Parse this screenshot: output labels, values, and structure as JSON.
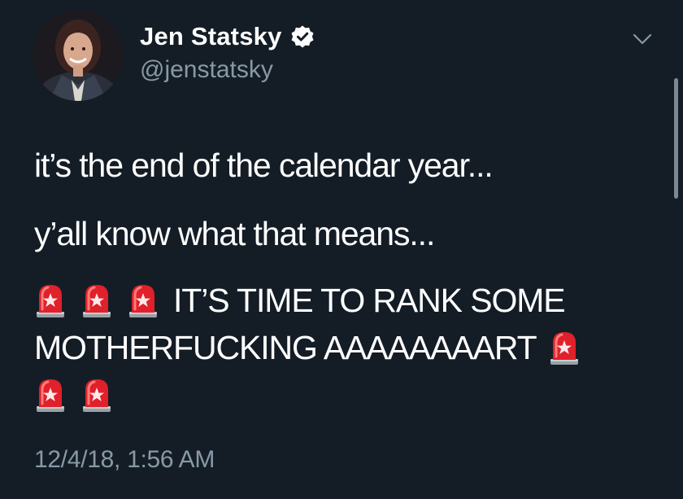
{
  "author": {
    "display_name": "Jen Statsky",
    "handle": "@jenstatsky",
    "verified": true
  },
  "tweet": {
    "line_1": "it’s the end of the calendar year...",
    "line_2": "y’all know what that means...",
    "line_3a": "IT’S TIME TO RANK SOME",
    "line_3b": "MOTHERFUCKING AAAAAAAART",
    "emoji": "siren-icon"
  },
  "timestamp": "12/4/18, 1:56 AM",
  "icons": [
    "verified-badge-icon",
    "chevron-down-icon",
    "siren-icon"
  ],
  "colors": {
    "background": "#141d26",
    "text": "#ffffff",
    "secondary_text": "#8899a6",
    "siren_red": "#e0202a"
  }
}
